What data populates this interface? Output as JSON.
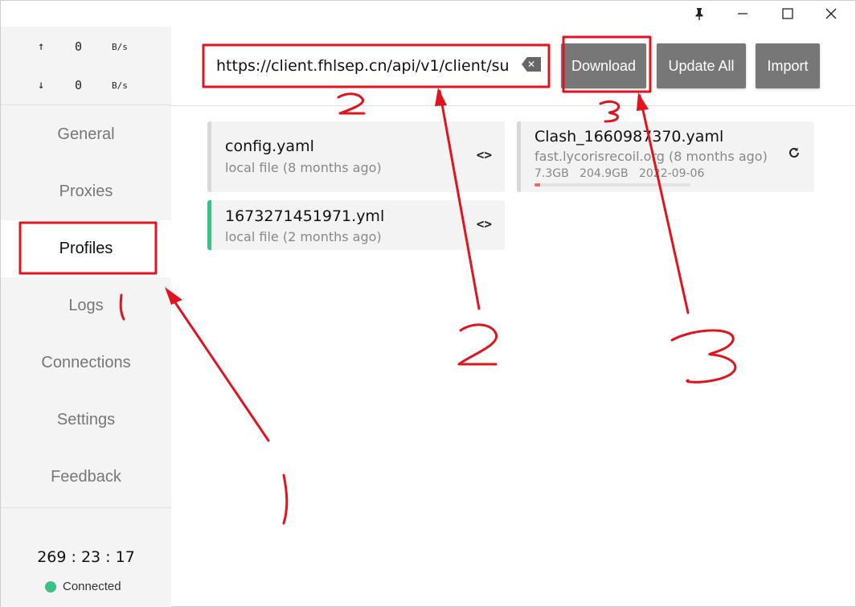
{
  "titlebar": {
    "pin_icon": "pin-icon",
    "minimize_icon": "minimize-icon",
    "maximize_icon": "maximize-icon",
    "close_icon": "close-icon"
  },
  "traffic": {
    "upload": {
      "arrow": "↑",
      "value": "0",
      "unit": "B/s"
    },
    "download": {
      "arrow": "↓",
      "value": "0",
      "unit": "B/s"
    }
  },
  "nav": {
    "items": [
      {
        "label": "General"
      },
      {
        "label": "Proxies"
      },
      {
        "label": "Profiles"
      },
      {
        "label": "Logs"
      },
      {
        "label": "Connections"
      },
      {
        "label": "Settings"
      },
      {
        "label": "Feedback"
      }
    ],
    "active": "Profiles"
  },
  "status": {
    "uptime": "269 : 23 : 17",
    "connection": "Connected",
    "connection_color": "#3dbf86"
  },
  "toolbar": {
    "url_value": "https://client.fhlsep.cn/api/v1/client/su",
    "download_label": "Download",
    "update_all_label": "Update All",
    "import_label": "Import"
  },
  "profiles": [
    {
      "name": "config.yaml",
      "sub": "local file (8 months ago)",
      "active": false
    },
    {
      "name": "1673271451971.yml",
      "sub": "local file (2 months ago)",
      "active": true
    },
    {
      "name": "Clash_1660987370.yaml",
      "sub": "fast.lycorisrecoil.org (8 months ago)",
      "used": "7.3GB",
      "total": "204.9GB",
      "expire": "2022-09-06",
      "usage_fraction": 0.036
    }
  ],
  "annotations": {
    "color": "#e0141e",
    "labels": [
      "1",
      "2",
      "3"
    ]
  }
}
